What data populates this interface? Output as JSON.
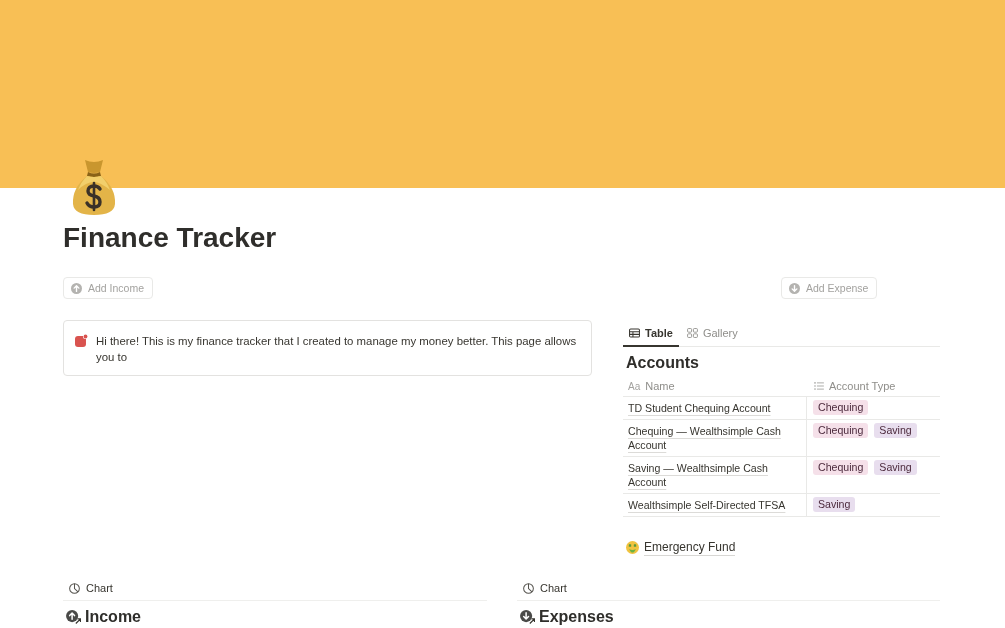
{
  "page": {
    "title": "Finance Tracker"
  },
  "buttons": [
    {
      "label": "Add Income",
      "kind": "income"
    },
    {
      "label": "Add Expense",
      "kind": "expense"
    }
  ],
  "callout": {
    "text": "Hi there! This is my finance tracker that I created to manage my money better. This page allows you to"
  },
  "accounts": {
    "tabs": [
      {
        "label": "Table",
        "kind": "table",
        "selected": true
      },
      {
        "label": "Gallery",
        "kind": "gallery",
        "selected": false
      }
    ],
    "title": "Accounts",
    "columns": [
      {
        "label": "Name",
        "kind": "title",
        "glyph": "Aa"
      },
      {
        "label": "Account Type",
        "kind": "multi_select"
      }
    ],
    "rows": [
      {
        "name": "TD Student Chequing Account",
        "tags": [
          {
            "label": "Chequing",
            "color": "#f5e0e9"
          }
        ]
      },
      {
        "name": "Chequing — Wealthsimple Cash Account",
        "tags": [
          {
            "label": "Chequing",
            "color": "#f5e0e9"
          },
          {
            "label": "Saving",
            "color": "#e8deee"
          }
        ]
      },
      {
        "name": "Saving — Wealthsimple Cash Account",
        "tags": [
          {
            "label": "Chequing",
            "color": "#f5e0e9"
          },
          {
            "label": "Saving",
            "color": "#e8deee"
          }
        ]
      },
      {
        "name": "Wealthsimple Self-Directed TFSA",
        "tags": [
          {
            "label": "Saving",
            "color": "#e8deee"
          }
        ]
      }
    ]
  },
  "link": {
    "label": "Emergency Fund"
  },
  "sections": [
    {
      "view": "Chart",
      "title": "Income",
      "kind": "income"
    },
    {
      "view": "Chart",
      "title": "Expenses",
      "kind": "expense"
    }
  ]
}
